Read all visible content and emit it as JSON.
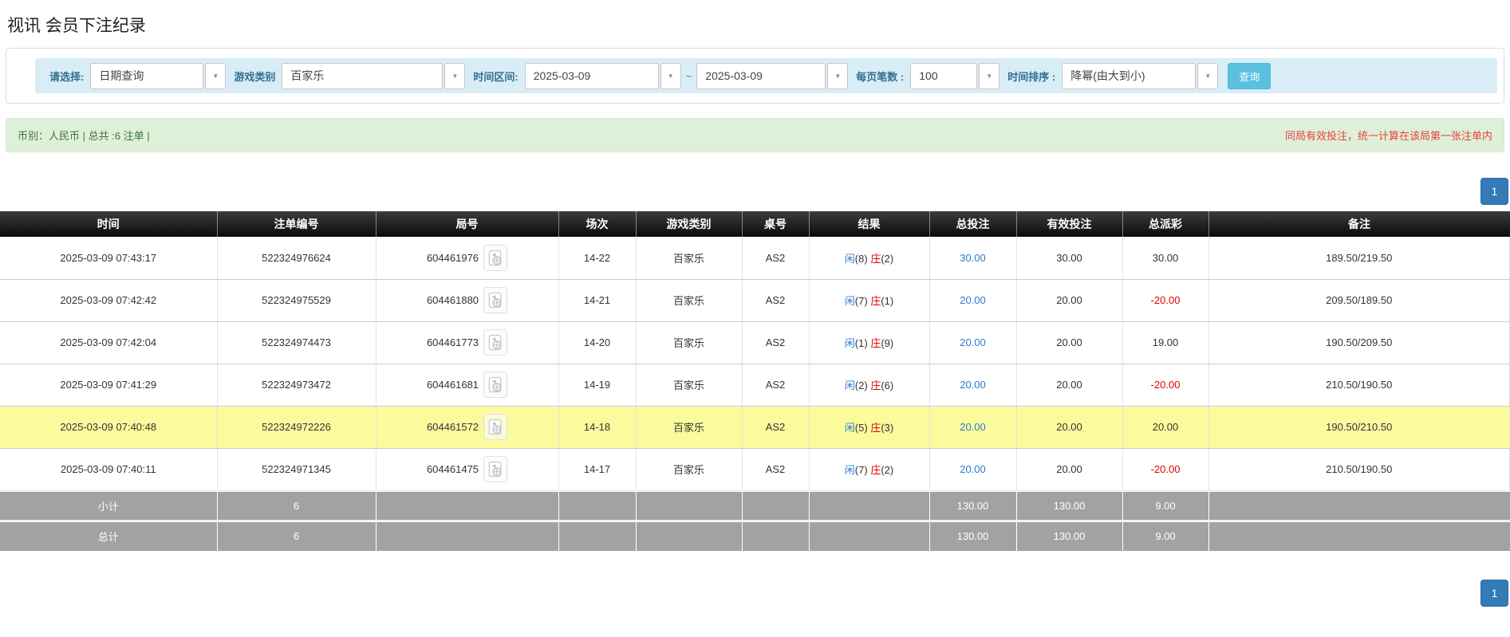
{
  "page": {
    "title": "视讯 会员下注纪录"
  },
  "filters": {
    "label_query_type": "请选择:",
    "query_type_value": "日期查询",
    "label_game_type": "游戏类别",
    "game_type_value": "百家乐",
    "label_time_range": "时间区间:",
    "date_from": "2025-03-09",
    "range_separator": "~",
    "date_to": "2025-03-09",
    "label_page_size": "每页笔数 :",
    "page_size_value": "100",
    "label_time_sort": "时间排序 :",
    "time_sort_value": "降幂(由大到小)",
    "search_button": "查询"
  },
  "summary_bar": {
    "currency_total": "币别：人民币 | 总共 :6 注单 |",
    "note": "同局有效投注，统一计算在该局第一张注单内"
  },
  "pagination": {
    "page": "1"
  },
  "table": {
    "headers": [
      "时间",
      "注单编号",
      "局号",
      "场次",
      "游戏类别",
      "桌号",
      "结果",
      "总投注",
      "有效投注",
      "总派彩",
      "备注"
    ],
    "rows": [
      {
        "time": "2025-03-09 07:43:17",
        "bet_id": "522324976624",
        "round_id": "604461976",
        "session": "14-22",
        "game": "百家乐",
        "table_no": "AS2",
        "result_player": "闲",
        "result_player_n": "(8)",
        "result_banker": "庄",
        "result_banker_n": "(2)",
        "total_bet": "30.00",
        "valid_bet": "30.00",
        "payout": "30.00",
        "remark": "189.50/219.50",
        "highlight": false
      },
      {
        "time": "2025-03-09 07:42:42",
        "bet_id": "522324975529",
        "round_id": "604461880",
        "session": "14-21",
        "game": "百家乐",
        "table_no": "AS2",
        "result_player": "闲",
        "result_player_n": "(7)",
        "result_banker": "庄",
        "result_banker_n": "(1)",
        "total_bet": "20.00",
        "valid_bet": "20.00",
        "payout": "-20.00",
        "remark": "209.50/189.50",
        "highlight": false
      },
      {
        "time": "2025-03-09 07:42:04",
        "bet_id": "522324974473",
        "round_id": "604461773",
        "session": "14-20",
        "game": "百家乐",
        "table_no": "AS2",
        "result_player": "闲",
        "result_player_n": "(1)",
        "result_banker": "庄",
        "result_banker_n": "(9)",
        "total_bet": "20.00",
        "valid_bet": "20.00",
        "payout": "19.00",
        "remark": "190.50/209.50",
        "highlight": false
      },
      {
        "time": "2025-03-09 07:41:29",
        "bet_id": "522324973472",
        "round_id": "604461681",
        "session": "14-19",
        "game": "百家乐",
        "table_no": "AS2",
        "result_player": "闲",
        "result_player_n": "(2)",
        "result_banker": "庄",
        "result_banker_n": "(6)",
        "total_bet": "20.00",
        "valid_bet": "20.00",
        "payout": "-20.00",
        "remark": "210.50/190.50",
        "highlight": false
      },
      {
        "time": "2025-03-09 07:40:48",
        "bet_id": "522324972226",
        "round_id": "604461572",
        "session": "14-18",
        "game": "百家乐",
        "table_no": "AS2",
        "result_player": "闲",
        "result_player_n": "(5)",
        "result_banker": "庄",
        "result_banker_n": "(3)",
        "total_bet": "20.00",
        "valid_bet": "20.00",
        "payout": "20.00",
        "remark": "190.50/210.50",
        "highlight": true
      },
      {
        "time": "2025-03-09 07:40:11",
        "bet_id": "522324971345",
        "round_id": "604461475",
        "session": "14-17",
        "game": "百家乐",
        "table_no": "AS2",
        "result_player": "闲",
        "result_player_n": "(7)",
        "result_banker": "庄",
        "result_banker_n": "(2)",
        "total_bet": "20.00",
        "valid_bet": "20.00",
        "payout": "-20.00",
        "remark": "210.50/190.50",
        "highlight": false
      }
    ],
    "subtotal": {
      "label": "小计",
      "count": "6",
      "total_bet": "130.00",
      "valid_bet": "130.00",
      "payout": "9.00"
    },
    "total": {
      "label": "总计",
      "count": "6",
      "total_bet": "130.00",
      "valid_bet": "130.00",
      "payout": "9.00"
    }
  },
  "icons": {
    "dropdown": "chevron-down-icon",
    "video": "video-file-icon"
  },
  "colors": {
    "header_bg": "#1a1a1a",
    "highlight_row": "#fbfb9d",
    "link_blue": "#2b7bd0",
    "negative_red": "#e60000",
    "banker_red": "#e60000",
    "success_bg": "#dff0d8",
    "success_text": "#3c763d",
    "note_red": "#e8403f",
    "filter_bg": "#d9edf7",
    "filter_label": "#31708f",
    "search_button": "#5bc0de",
    "pager_blue": "#337ab7",
    "summary_gray": "#a2a2a2"
  }
}
